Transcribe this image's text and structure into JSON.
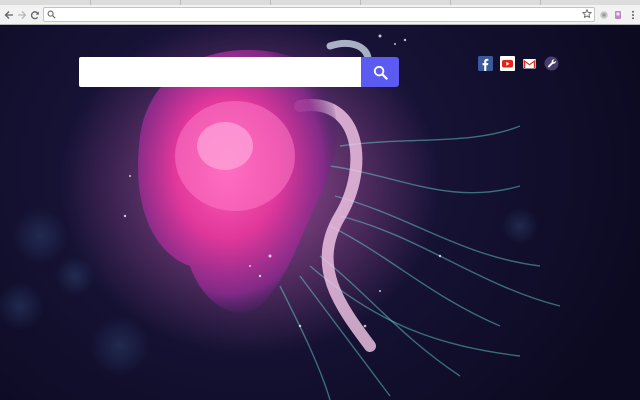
{
  "browser": {
    "address_value": "",
    "nav": {
      "back_icon": "back-arrow-icon",
      "forward_icon": "forward-arrow-icon",
      "reload_icon": "reload-icon"
    },
    "bookmark_icon": "star-icon",
    "extensions": [
      "extension-icon",
      "profile-icon",
      "menu-dots-icon"
    ]
  },
  "page": {
    "search": {
      "value": "",
      "button_icon": "search-icon",
      "button_color": "#5b5bf2"
    },
    "shortcuts": [
      {
        "name": "facebook",
        "icon": "facebook-icon",
        "color": "#3b5998"
      },
      {
        "name": "youtube",
        "icon": "youtube-icon",
        "color": "#e62117"
      },
      {
        "name": "gmail",
        "icon": "gmail-icon",
        "color": "#d93025"
      },
      {
        "name": "settings",
        "icon": "wrench-icon",
        "color": "#5a4a7a"
      }
    ],
    "background": "jellyfish-wallpaper"
  }
}
